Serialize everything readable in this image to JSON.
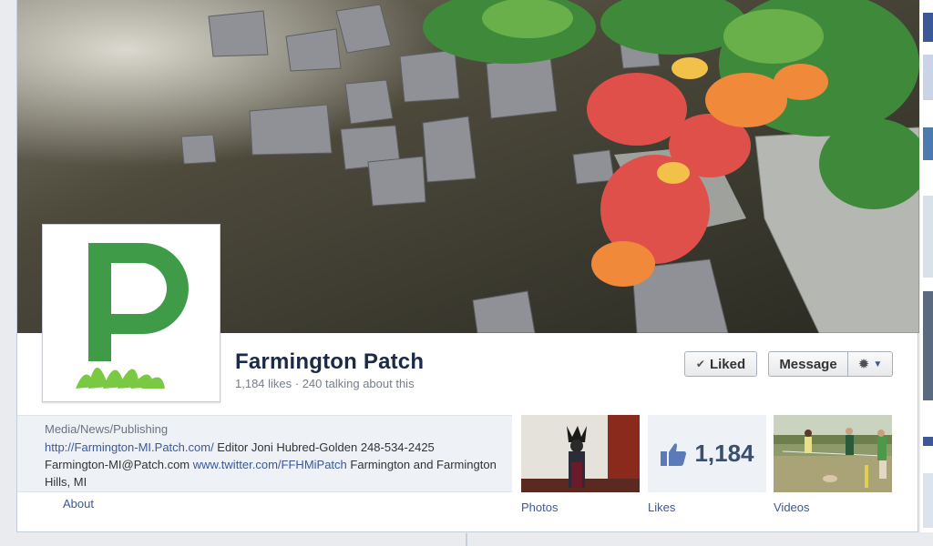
{
  "page": {
    "name": "Farmington Patch",
    "stats": "1,184 likes · 240 talking about this"
  },
  "buttons": {
    "liked": "Liked",
    "message": "Message"
  },
  "about": {
    "category": "Media/News/Publishing",
    "website": "http://Farmington-MI.Patch.com/",
    "text_editor": " Editor Joni Hubred-Golden 248-534-2425 Farmington-MI@Patch.com ",
    "twitter": "www.twitter.com/FFHMiPatch",
    "text_location": " Farmington and Farmington Hills, MI",
    "label": "About"
  },
  "apps": {
    "photos_label": "Photos",
    "likes_label": "Likes",
    "likes_count": "1,184",
    "videos_label": "Videos"
  },
  "icons": {
    "liked": "check-icon",
    "gear": "gear-icon",
    "caret": "caret-down-icon",
    "thumb": "thumbs-up-icon"
  },
  "colors": {
    "link": "#3b5998",
    "logo_green": "#3f9b48",
    "name": "#1c2a47"
  }
}
